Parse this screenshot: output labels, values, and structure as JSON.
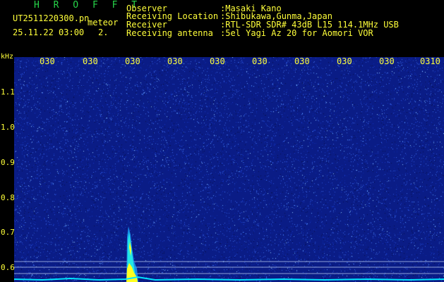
{
  "header": {
    "app_title": "H R O F F T",
    "file_name": "UT2511220300.pn",
    "meteor_label": "meteor",
    "date_time": "25.11.22 03:00",
    "count": "2."
  },
  "info": {
    "observer_label": "Observer",
    "observer_value": ":Masaki Kano",
    "location_label": "Receiving Location",
    "location_value": ":Shibukawa,Gunma,Japan",
    "receiver_label": "Receiver",
    "receiver_value": ":RTL-SDR SDR# 43dB L15 114.1MHz USB",
    "antenna_label": "Receiving antenna",
    "antenna_value": ":5el Yagi Az 20 for Aomori VOR"
  },
  "axis": {
    "unit_label": "kHz",
    "time_ticks": [
      "030",
      "030",
      "030",
      "030",
      "030",
      "030",
      "030",
      "030",
      "030",
      "0310"
    ],
    "freq_ticks": [
      "1.1",
      "1.0",
      "0.9",
      "0.8",
      "0.7",
      "0.6"
    ]
  },
  "colors": {
    "background": "#0a1c86",
    "text": "#ffff3a",
    "title": "#27d64a",
    "trace": "#00e5ff"
  }
}
